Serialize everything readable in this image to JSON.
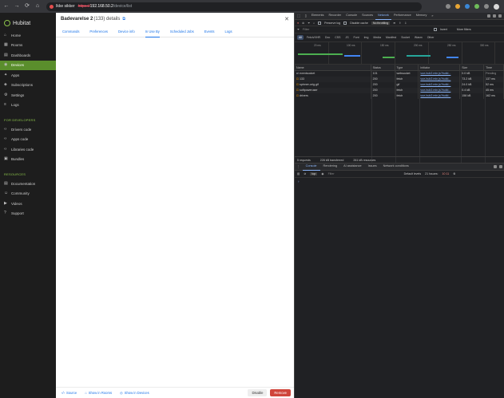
{
  "browser": {
    "nav": [
      "←",
      "→",
      "⟳",
      "⌂"
    ],
    "insecure_label": "Ikke sikker",
    "url_scheme": "https://",
    "url_host": "192.168.50.2",
    "url_path": "/device/list"
  },
  "sidebar": {
    "logo": "Hubitat",
    "items": [
      {
        "label": "Home",
        "icon": "⌂"
      },
      {
        "label": "Rooms",
        "icon": "▦"
      },
      {
        "label": "Dashboards",
        "icon": "▤"
      },
      {
        "label": "Devices",
        "icon": "◉",
        "active": true
      },
      {
        "label": "Apps",
        "icon": "✦"
      },
      {
        "label": "Subscriptions",
        "icon": "◈"
      },
      {
        "label": "Settings",
        "icon": "⚙"
      },
      {
        "label": "Logs",
        "icon": "≡"
      }
    ],
    "dev_section": "FOR DEVELOPERS",
    "dev_items": [
      {
        "label": "Drivers code",
        "icon": "‹›"
      },
      {
        "label": "Apps code",
        "icon": "‹›"
      },
      {
        "label": "Libraries code",
        "icon": "‹›"
      },
      {
        "label": "Bundles",
        "icon": "▣"
      }
    ],
    "res_section": "RESOURCES",
    "res_items": [
      {
        "label": "Documentation",
        "icon": "▤"
      },
      {
        "label": "Community",
        "icon": "☺"
      },
      {
        "label": "Videos",
        "icon": "▶"
      },
      {
        "label": "Support",
        "icon": "?"
      }
    ]
  },
  "main": {
    "title": "Badevarelse 2",
    "title_sub": "(133) details",
    "ext_icon": "⧉",
    "close": "✕",
    "tabs": [
      "Commands",
      "Preferences",
      "Device info",
      "In Use By",
      "Scheduled Jobs",
      "Events",
      "Logs"
    ],
    "selected_tab": 3,
    "footer_links": [
      {
        "icon": "‹/›",
        "label": "Source"
      },
      {
        "icon": "⌂",
        "label": "Show in Rooms"
      },
      {
        "icon": "◎",
        "label": "Show in Devices"
      }
    ],
    "disable_label": "Disable",
    "remove_label": "Remove"
  },
  "devtools": {
    "tabs": [
      "Elements",
      "Recorder",
      "Console",
      "Sources",
      "Network",
      "Performance",
      "Memory"
    ],
    "selected_tab": 4,
    "more": "»",
    "toolbar": {
      "preserve_log": "Preserve log",
      "disable_cache": "Disable cache",
      "throttling": "No throttling"
    },
    "filter_placeholder": "Filter",
    "invert": "Invert",
    "more_filters": "More filters",
    "types": [
      "All",
      "Fetch/XHR",
      "Doc",
      "CSS",
      "JS",
      "Font",
      "Img",
      "Media",
      "Manifest",
      "Socket",
      "Wasm",
      "Other"
    ],
    "timeline_ticks": [
      "20 ms",
      "100 ms",
      "150 ms",
      "200 ms",
      "250 ms",
      "300 ms"
    ],
    "columns": [
      "Name",
      "Status",
      "Type",
      "Initiator",
      "Size",
      "Time"
    ],
    "rows": [
      {
        "name": "eventsocket",
        "status": "101",
        "type": "websocket",
        "initiator": "vue-hub2.min.js?build...",
        "size": "0.0 kB",
        "time": "Pending"
      },
      {
        "name": "133",
        "status": "200",
        "type": "fetch",
        "initiator": "vue-hub2.min.js?build...",
        "size": "73.2 kB",
        "time": "137 ms"
      },
      {
        "name": "spinner-orig.gif",
        "status": "200",
        "type": "gif",
        "initiator": "vue-hub2.min.js?build...",
        "size": "24.0 kB",
        "time": "52 ms"
      },
      {
        "name": "softpoweruser",
        "status": "200",
        "type": "fetch",
        "initiator": "vue-hub2.min.js?build...",
        "size": "0.4 kB",
        "time": "45 ms"
      },
      {
        "name": "drivers",
        "status": "200",
        "type": "fetch",
        "initiator": "vue-hub2.min.js?build...",
        "size": "158 kB",
        "time": "162 ms"
      }
    ],
    "status_bar": [
      "5 requests",
      "228 kB transferred",
      "261 kB resources"
    ],
    "drawer_tabs": [
      "Console",
      "Rendering",
      "AI assistance",
      "Issues",
      "Network conditions"
    ],
    "drawer_selected": 0,
    "console": {
      "context": "top",
      "filter": "Filter",
      "levels": "Default levels",
      "issues": "21 Issues:",
      "issue_counts": "10  11"
    },
    "prompt": "›"
  }
}
